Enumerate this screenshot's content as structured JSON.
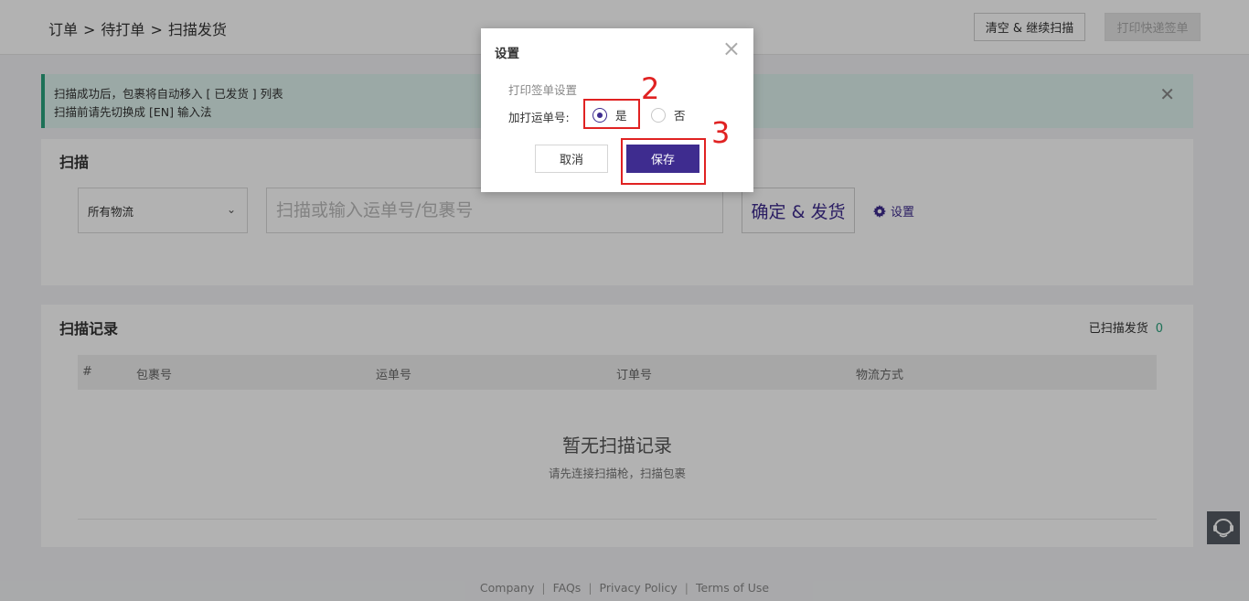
{
  "header": {
    "breadcrumb": [
      "订单",
      ">",
      "待打单",
      ">",
      "扫描发货"
    ],
    "clear_button": "清空 & 继续扫描",
    "print_button": "打印快递签单"
  },
  "alert": {
    "line1": "扫描成功后，包裹将自动移入 [ 已发货 ] 列表",
    "line2": "扫描前请先切换成 [EN] 输入法",
    "close": "✕"
  },
  "scan": {
    "title": "扫描",
    "carrier_selected": "所有物流",
    "input_placeholder": "扫描或输入运单号/包裹号",
    "confirm_button": "确定 & 发货",
    "settings_link": "设置"
  },
  "records": {
    "title": "扫描记录",
    "count_label": "已扫描发货",
    "count": "0",
    "columns": [
      "#",
      "包裹号",
      "运单号",
      "订单号",
      "物流方式"
    ],
    "empty_title": "暂无扫描记录",
    "empty_subtitle": "请先连接扫描枪，扫描包裹"
  },
  "footer": {
    "links": [
      "Company",
      "FAQs",
      "Privacy Policy",
      "Terms of Use"
    ]
  },
  "modal": {
    "title": "设置",
    "close": "×",
    "section_label": "打印签单设置",
    "field_label": "加打运单号:",
    "option_yes": "是",
    "option_no": "否",
    "selected": "是",
    "cancel_button": "取消",
    "save_button": "保存"
  },
  "annotations": {
    "step2": "2",
    "step3": "3"
  },
  "colors": {
    "accent": "#3e2c8f",
    "success": "#2aa37d",
    "annotation": "#e02222"
  },
  "icons": [
    "chevron-down-icon",
    "gear-icon",
    "close-icon",
    "headset-icon"
  ]
}
